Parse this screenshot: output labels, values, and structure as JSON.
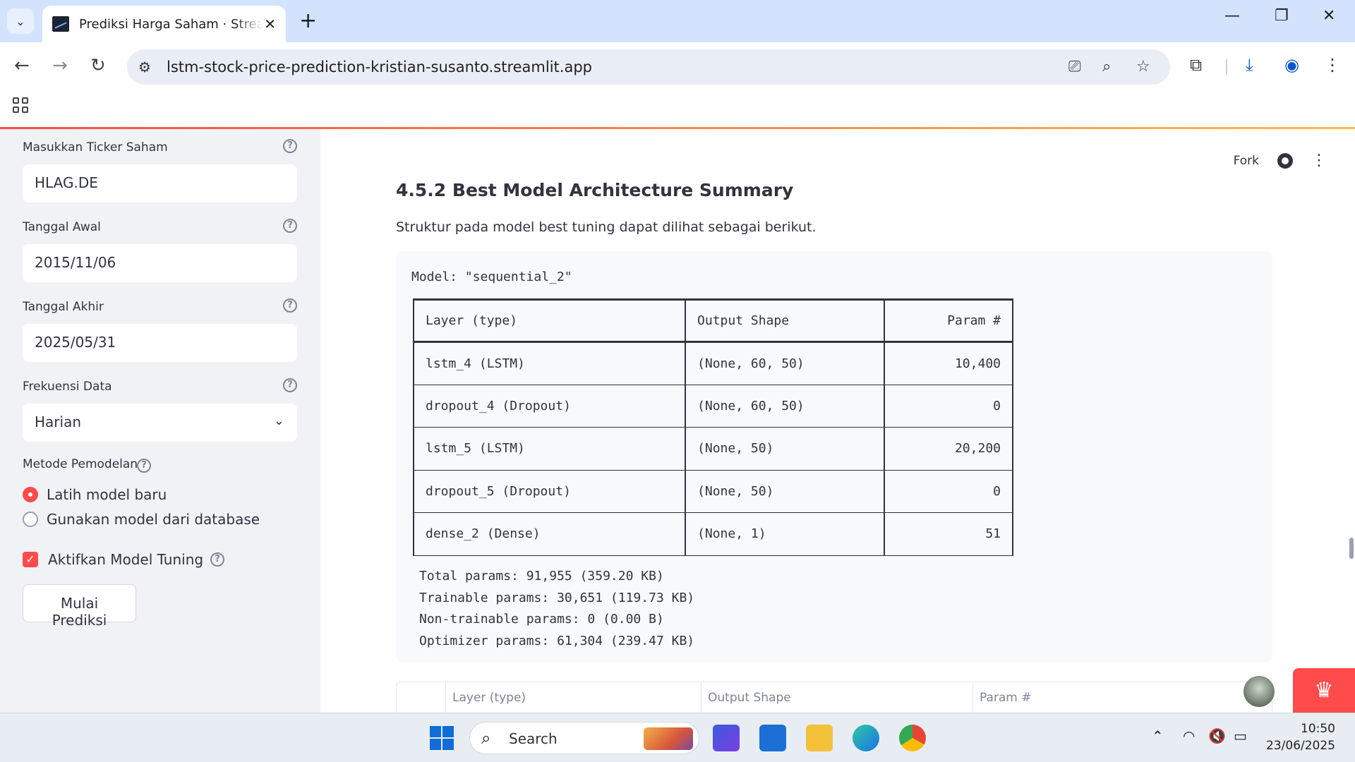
{
  "browser": {
    "tab_title": "Prediksi Harga Saham · Streamlit",
    "url": "lstm-stock-price-prediction-kristian-susanto.streamlit.app"
  },
  "sidebar": {
    "ticker": {
      "label": "Masukkan Ticker Saham",
      "value": "HLAG.DE"
    },
    "start_date": {
      "label": "Tanggal Awal",
      "value": "2015/11/06"
    },
    "end_date": {
      "label": "Tanggal Akhir",
      "value": "2025/05/31"
    },
    "frequency": {
      "label": "Frekuensi Data",
      "value": "Harian"
    },
    "method": {
      "label": "Metode Pemodelan",
      "options": [
        "Latih model baru",
        "Gunakan model dari database"
      ],
      "selected": "Latih model baru"
    },
    "tuning": {
      "label": "Aktifkan Model Tuning",
      "checked": true
    },
    "predict_button": "Mulai Prediksi",
    "help_glyph": "?"
  },
  "header": {
    "fork_label": "Fork"
  },
  "main": {
    "heading": "4.5.2 Best Model Architecture Summary",
    "paragraph": "Struktur pada model best tuning dapat dilihat sebagai berikut.",
    "model_line": "Model: \"sequential_2\"",
    "table": {
      "headers": [
        "Layer (type)",
        "Output Shape",
        "Param #"
      ],
      "rows": [
        [
          "lstm_4 (LSTM)",
          "(None, 60, 50)",
          "10,400"
        ],
        [
          "dropout_4 (Dropout)",
          "(None, 60, 50)",
          "0"
        ],
        [
          "lstm_5 (LSTM)",
          "(None, 50)",
          "20,200"
        ],
        [
          "dropout_5 (Dropout)",
          "(None, 50)",
          "0"
        ],
        [
          "dense_2 (Dense)",
          "(None, 1)",
          "51"
        ]
      ]
    },
    "summary": [
      "Total params: 91,955 (359.20 KB)",
      "Trainable params: 30,651 (119.73 KB)",
      "Non-trainable params: 0 (0.00 B)",
      "Optimizer params: 61,304 (239.47 KB)"
    ],
    "dataframe_headers": [
      "Layer (type)",
      "Output Shape",
      "Param #"
    ]
  },
  "taskbar": {
    "search_label": "Search",
    "time": "10:50",
    "date": "23/06/2025"
  },
  "colors": {
    "accent": "#ff4b4b",
    "sidebar_bg": "#f0f2f6",
    "tabbar_bg": "#d3e3fd"
  },
  "icons": [
    "tab-list-icon",
    "close-icon",
    "plus-icon",
    "minimize-icon",
    "restore-icon",
    "back-icon",
    "forward-icon",
    "reload-icon",
    "site-settings-icon",
    "install-icon",
    "zoom-icon",
    "star-icon",
    "extensions-icon",
    "download-icon",
    "profile-icon",
    "menu-icon",
    "apps-icon",
    "help-icon",
    "chevron-down-icon",
    "github-icon",
    "search-icon",
    "wifi-icon",
    "mute-icon",
    "battery-icon"
  ]
}
